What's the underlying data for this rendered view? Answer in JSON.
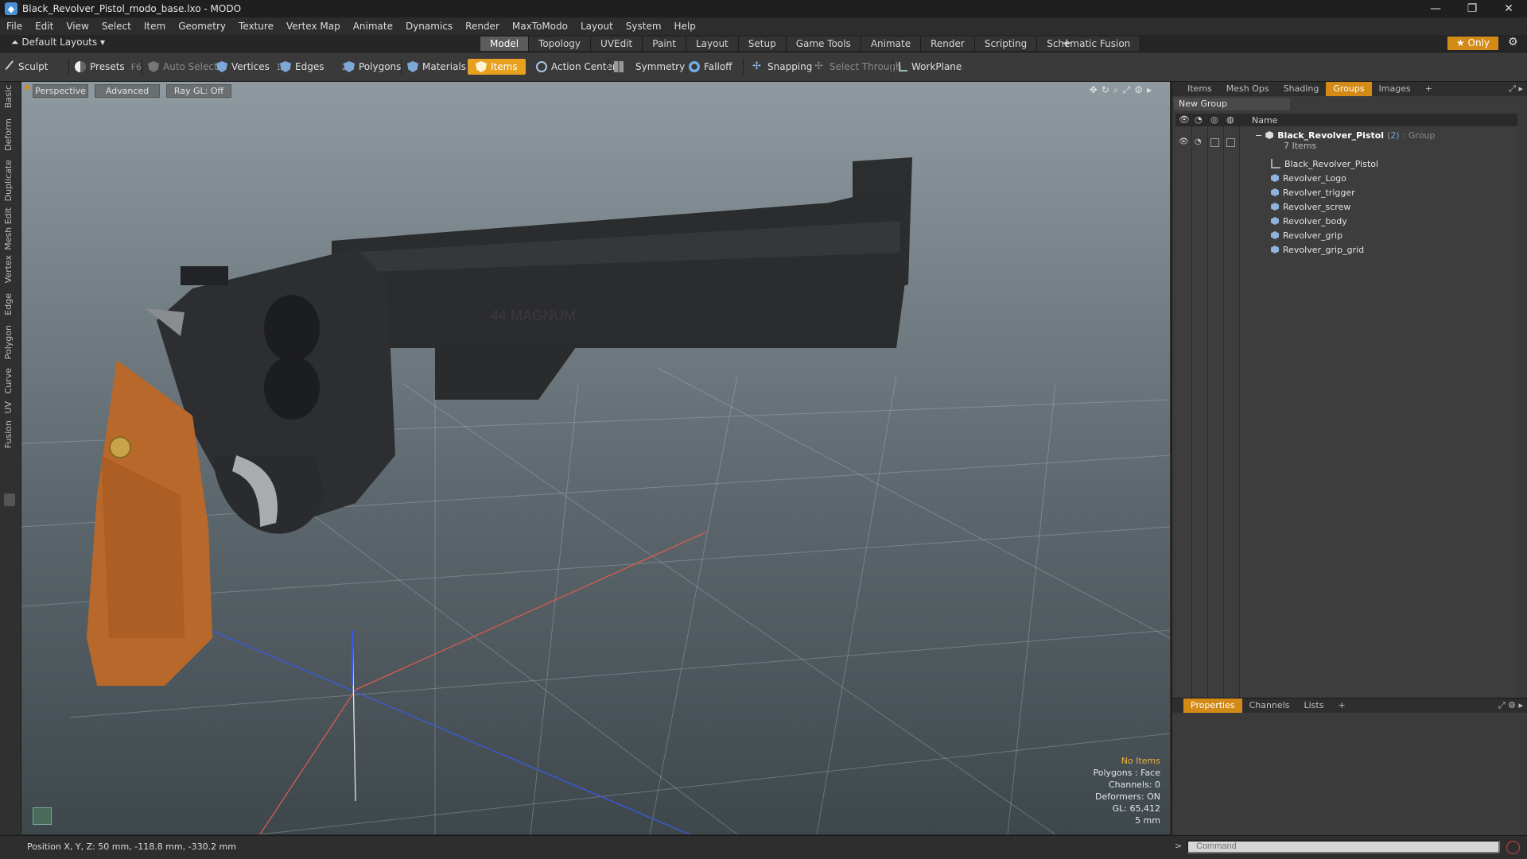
{
  "window": {
    "title": "Black_Revolver_Pistol_modo_base.lxo - MODO",
    "controls": [
      "—",
      "❐",
      "✕"
    ]
  },
  "menu": [
    "File",
    "Edit",
    "View",
    "Select",
    "Item",
    "Geometry",
    "Texture",
    "Vertex Map",
    "Animate",
    "Dynamics",
    "Render",
    "MaxToModo",
    "Layout",
    "System",
    "Help"
  ],
  "layout": {
    "name": "Default Layouts ▾",
    "tabs": [
      "Model",
      "Topology",
      "UVEdit",
      "Paint",
      "Layout",
      "Setup",
      "Game Tools",
      "Animate",
      "Render",
      "Scripting",
      "Schematic Fusion"
    ],
    "active_tab": "Model",
    "plus": "+",
    "only_label": "★  Only"
  },
  "toolbar": {
    "sculpt": "Sculpt",
    "presets": "Presets",
    "presets_key": "F6",
    "auto_select": "Auto Select",
    "vertices": "Vertices",
    "vertices_count": "1",
    "edges": "Edges",
    "edges_count": "2",
    "polygons": "Polygons",
    "materials": "Materials",
    "items": "Items",
    "action_center": "Action Center",
    "symmetry": "Symmetry",
    "falloff": "Falloff",
    "snapping": "Snapping",
    "select_through": "Select Through",
    "workplane": "WorkPlane"
  },
  "left_tabs": [
    "Basic",
    "Deform",
    "Duplicate",
    "Mesh Edit",
    "Vertex",
    "Edge",
    "Polygon",
    "Curve",
    "UV",
    "Fusion"
  ],
  "viewport": {
    "view_label": "Perspective",
    "shading_label": "Advanced",
    "raygl_label": "Ray GL: Off",
    "barrel_text": "44 MAGNUM",
    "info": {
      "selection": "No Items",
      "polygons": "Polygons : Face",
      "channels": "Channels: 0",
      "deformers": "Deformers: ON",
      "gl": "GL: 65,412",
      "grid": "5 mm"
    }
  },
  "groups_panel": {
    "tabs": [
      "Items",
      "Mesh Ops",
      "Shading",
      "Groups",
      "Images",
      "+"
    ],
    "active_tab": "Groups",
    "new_group": "New Group",
    "column_name": "Name",
    "group": {
      "name": "Black_Revolver_Pistol",
      "count": "(2)",
      "type": ": Group",
      "summary": "7 Items"
    },
    "items": [
      "Black_Revolver_Pistol",
      "Revolver_Logo",
      "Revolver_trigger",
      "Revolver_screw",
      "Revolver_body",
      "Revolver_grip",
      "Revolver_grip_grid"
    ]
  },
  "properties_panel": {
    "tabs": [
      "Properties",
      "Channels",
      "Lists",
      "+"
    ],
    "active_tab": "Properties"
  },
  "status": {
    "position": "Position X, Y, Z:  50 mm, -118.8 mm, -330.2 mm",
    "command_placeholder": "Command",
    "command_arrow": ">"
  },
  "colors": {
    "accent": "#d48a16",
    "items_button": "#e8a11e",
    "viewport_top": "#8e9aa0",
    "viewport_bottom": "#3e474c"
  }
}
